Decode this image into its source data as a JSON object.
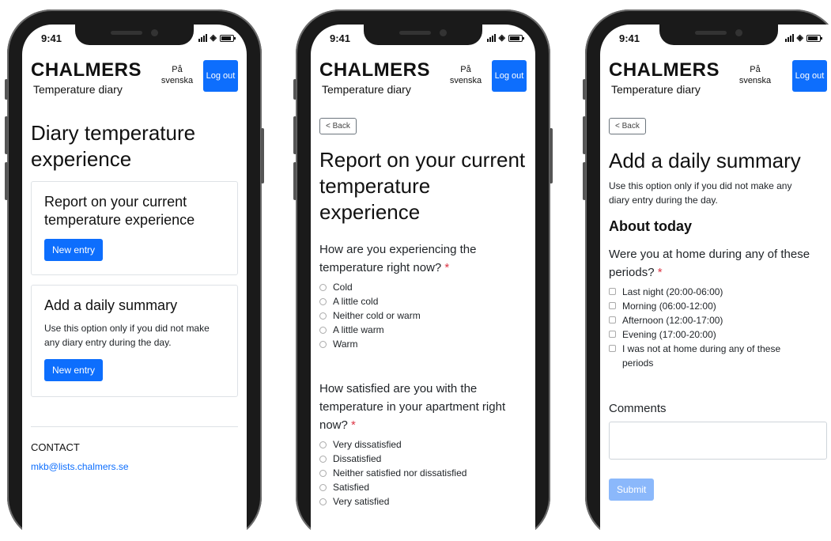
{
  "status": {
    "time": "9:41"
  },
  "header": {
    "brand": "CHALMERS",
    "subtitle": "Temperature diary",
    "language": "På svenska",
    "logout": "Log out"
  },
  "screen1": {
    "title": "Diary temperature experience",
    "card1": {
      "title": "Report on your current temperature experience",
      "button": "New entry"
    },
    "card2": {
      "title": "Add a daily summary",
      "text": "Use this option only if you did not make any diary entry during the day.",
      "button": "New entry"
    },
    "contact_heading": "CONTACT",
    "contact_email": "mkb@lists.chalmers.se"
  },
  "screen2": {
    "back": "< Back",
    "title": "Report on your current temperature experience",
    "q1": "How are you experiencing the temperature right now?",
    "q1_options": [
      "Cold",
      "A little cold",
      "Neither cold or warm",
      "A little warm",
      "Warm"
    ],
    "q2": "How satisfied are you with the temperature in your apartment right now?",
    "q2_options": [
      "Very dissatisfied",
      "Dissatisfied",
      "Neither satisfied nor dissatisfied",
      "Satisfied",
      "Very satisfied"
    ],
    "required_mark": "*"
  },
  "screen3": {
    "back": "< Back",
    "title": "Add a daily summary",
    "description": "Use this option only if you did not make any diary entry during the day.",
    "section": "About today",
    "question": "Were you at home during any of these periods?",
    "options": [
      "Last night (20:00-06:00)",
      "Morning (06:00-12:00)",
      "Afternoon (12:00-17:00)",
      "Evening (17:00-20:00)",
      "I was not at home during any of these periods"
    ],
    "comments_label": "Comments",
    "submit": "Submit",
    "required_mark": "*"
  },
  "colors": {
    "primary": "#0d6efd",
    "required": "#dc3545",
    "disabled": "#8bb8fb"
  }
}
